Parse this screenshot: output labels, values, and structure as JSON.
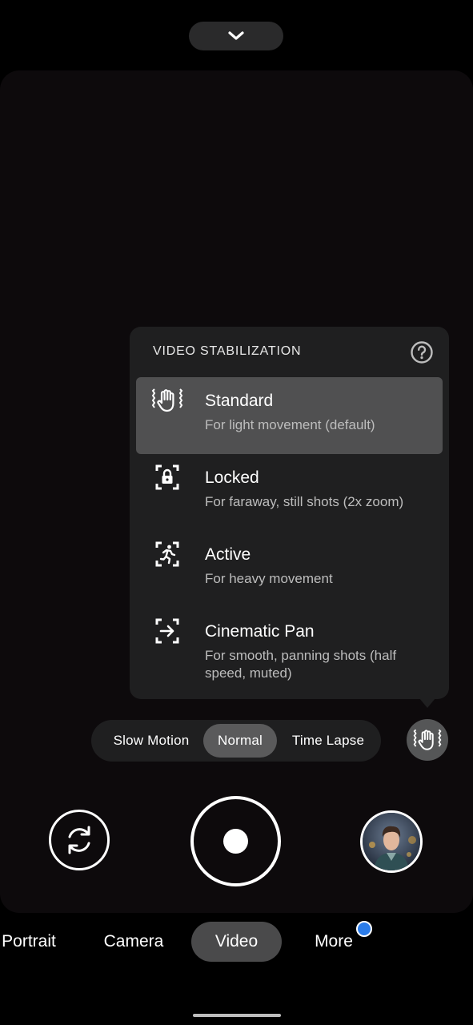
{
  "popup": {
    "title": "VIDEO STABILIZATION",
    "help_icon": "help-circle-icon",
    "options": [
      {
        "title": "Standard",
        "subtitle": "For light movement (default)",
        "icon": "hand-stabilization-icon",
        "selected": true
      },
      {
        "title": "Locked",
        "subtitle": "For faraway, still shots (2x zoom)",
        "icon": "lock-frame-icon",
        "selected": false
      },
      {
        "title": "Active",
        "subtitle": "For heavy movement",
        "icon": "running-person-frame-icon",
        "selected": false
      },
      {
        "title": "Cinematic Pan",
        "subtitle": "For smooth, panning shots (half speed, muted)",
        "icon": "arrow-frame-icon",
        "selected": false
      }
    ]
  },
  "speed_modes": [
    {
      "label": "Slow Motion",
      "active": false
    },
    {
      "label": "Normal",
      "active": true
    },
    {
      "label": "Time Lapse",
      "active": false
    }
  ],
  "camera_modes": [
    {
      "label": "Portrait",
      "active": false
    },
    {
      "label": "Camera",
      "active": false
    },
    {
      "label": "Video",
      "active": true
    },
    {
      "label": "More",
      "active": false
    }
  ],
  "icons": {
    "collapse": "chevron-down-icon",
    "stabilization_button": "hand-stabilization-icon",
    "flip_camera": "flip-camera-icon",
    "record": "record-icon",
    "gallery": "gallery-thumbnail",
    "more_badge": "notification-dot"
  },
  "colors": {
    "background": "#000000",
    "popup": "#1f1f20",
    "selected": "#505051",
    "badge": "#2b7ce9"
  }
}
